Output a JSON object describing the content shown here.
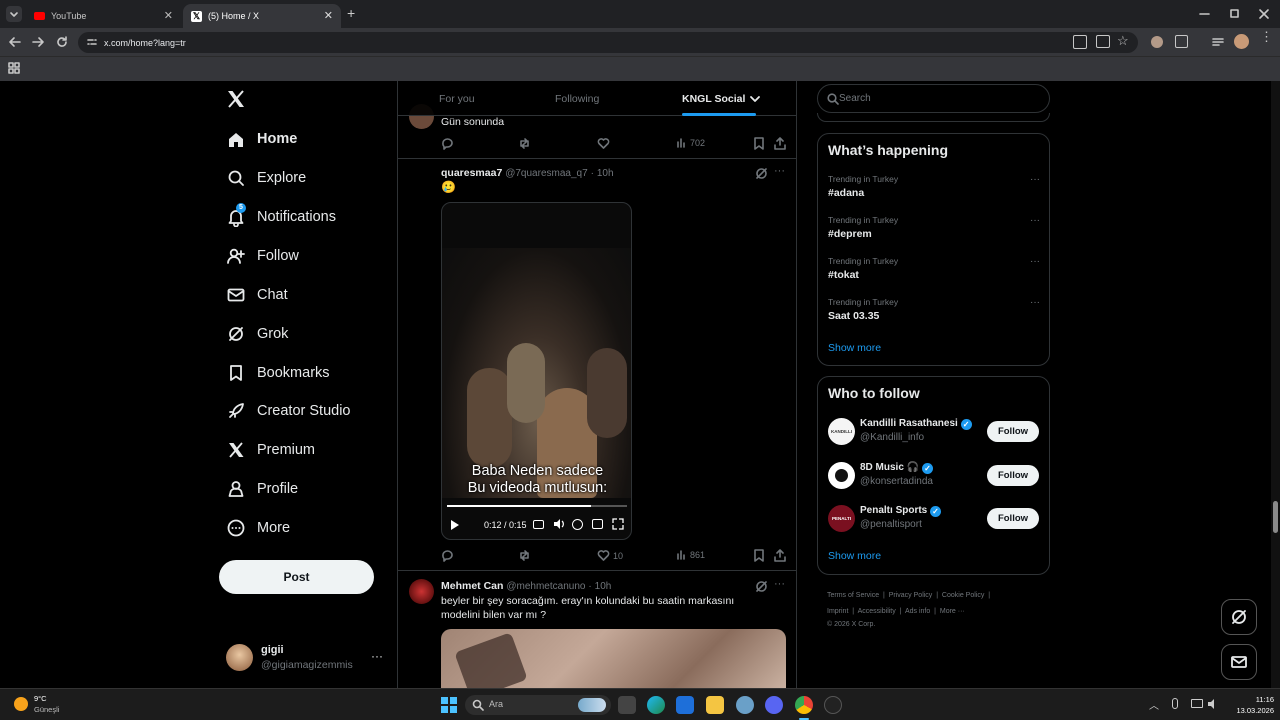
{
  "browser": {
    "tabs": [
      {
        "title": "YouTube",
        "active": false
      },
      {
        "title": "(5) Home / X",
        "active": true
      }
    ],
    "url": "x.com/home?lang=tr"
  },
  "nav": {
    "items": [
      {
        "label": "Home",
        "icon": "home-icon",
        "active": true
      },
      {
        "label": "Explore",
        "icon": "search-icon"
      },
      {
        "label": "Notifications",
        "icon": "bell-icon",
        "badge": "5"
      },
      {
        "label": "Follow",
        "icon": "person-add-icon"
      },
      {
        "label": "Chat",
        "icon": "mail-icon"
      },
      {
        "label": "Grok",
        "icon": "grok-icon"
      },
      {
        "label": "Bookmarks",
        "icon": "bookmark-icon"
      },
      {
        "label": "Creator Studio",
        "icon": "rocket-icon"
      },
      {
        "label": "Premium",
        "icon": "x-logo-icon"
      },
      {
        "label": "Profile",
        "icon": "person-icon"
      },
      {
        "label": "More",
        "icon": "more-circle-icon"
      }
    ],
    "post_label": "Post",
    "account": {
      "name": "gigii",
      "handle": "@gigiamagizemmis"
    }
  },
  "feed": {
    "tabs": [
      "For you",
      "Following",
      "KNGL Social"
    ],
    "active_tab": "KNGL Social",
    "tweet0": {
      "text": "Gün sonunda",
      "views": "702"
    },
    "tweet1": {
      "name": "quaresmaa7",
      "handle": "@7quaresmaa_q7",
      "time": "10h",
      "text": "🥲",
      "video_caption_1": "Baba Neden sadece",
      "video_caption_2": "Bu videoda mutlusun:",
      "video_time": "0:12 / 0:15",
      "likes": "10",
      "views": "861",
      "progress": 0.8
    },
    "tweet2": {
      "name": "Mehmet Can",
      "handle": "@mehmetcanuno",
      "time": "10h",
      "text": "beyler bir şey soracağım. eray'ın kolundaki bu saatin markasını modelini bilen var mı ?"
    }
  },
  "sidebar": {
    "search_placeholder": "Search",
    "happening_title": "What’s happening",
    "trends": [
      {
        "category": "Trending in Turkey",
        "name": "#adana"
      },
      {
        "category": "Trending in Turkey",
        "name": "#deprem"
      },
      {
        "category": "Trending in Turkey",
        "name": "#tokat"
      },
      {
        "category": "Trending in Turkey",
        "name": "Saat 03.35"
      }
    ],
    "show_more": "Show more",
    "wtf_title": "Who to follow",
    "follow_suggestions": [
      {
        "name": "Kandilli Rasathanesi",
        "handle": "@Kandilli_info",
        "verified": true
      },
      {
        "name": "8D Music 🎧",
        "handle": "@konsertadinda",
        "verified": true
      },
      {
        "name": "Penaltı Sports",
        "handle": "@penaltisport",
        "verified": true
      }
    ],
    "follow_label": "Follow",
    "footer": {
      "links1": [
        "Terms of Service",
        "Privacy Policy",
        "Cookie Policy"
      ],
      "links2": [
        "Imprint",
        "Accessibility",
        "Ads info",
        "More ···"
      ],
      "copyright": "© 2026 X Corp."
    }
  },
  "taskbar": {
    "weather_temp": "9°C",
    "weather_desc": "Güneşli",
    "search_placeholder": "Ara",
    "time": "11:16",
    "date": "13.03.2026"
  }
}
